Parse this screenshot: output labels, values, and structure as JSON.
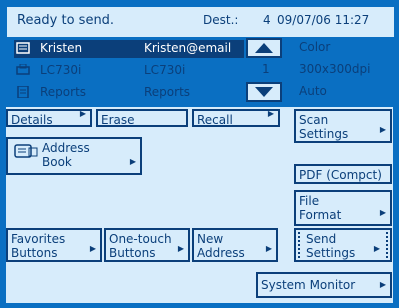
{
  "status": {
    "ready_text": "Ready to send.",
    "dest_label": "Dest.:",
    "dest_count": "4",
    "datetime": "09/07/06 11:27"
  },
  "destinations": [
    {
      "icon": "list-icon",
      "name": "Kristen",
      "address": "Kristen@email",
      "selected": true
    },
    {
      "icon": "fax-icon",
      "name": "LC730i",
      "address": "LC730i",
      "selected": false
    },
    {
      "icon": "document-icon",
      "name": "Reports",
      "address": "Reports",
      "selected": false
    }
  ],
  "pager": {
    "page": "1"
  },
  "settings": {
    "color": "Color",
    "resolution": "300x300dpi",
    "mode": "Auto"
  },
  "buttons": {
    "details": "Details",
    "erase": "Erase",
    "recall": "Recall",
    "scan_settings_1": "Scan",
    "scan_settings_2": "Settings",
    "address_book_1": "Address",
    "address_book_2": "Book",
    "pdf": "PDF (Compct)",
    "file_format_1": "File",
    "file_format_2": "Format",
    "favorites_1": "Favorites",
    "favorites_2": "Buttons",
    "onetouch_1": "One-touch",
    "onetouch_2": "Buttons",
    "new_address_1": "New",
    "new_address_2": "Address",
    "send_settings_1": "Send",
    "send_settings_2": "Settings",
    "system_monitor": "System Monitor"
  },
  "colors": {
    "frame": "#0a6fc2",
    "panel": "#d7ecfb",
    "text": "#0b3f7a",
    "highlight": "#0b3f7a"
  }
}
